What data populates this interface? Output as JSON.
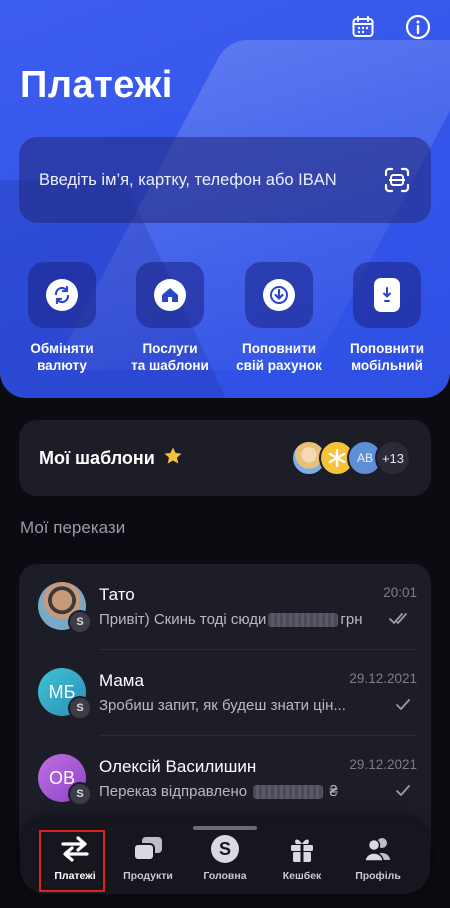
{
  "header": {
    "title": "Платежі",
    "calendar_icon": "calendar-icon",
    "info_icon": "info-icon"
  },
  "search": {
    "placeholder": "Введіть ім’я, картку, телефон або IBAN",
    "scan_icon": "scan-icon"
  },
  "actions": [
    {
      "label": "Обміняти\nвалюту",
      "icon": "exchange-icon"
    },
    {
      "label": "Послуги\nта шаблони",
      "icon": "home-icon"
    },
    {
      "label": "Поповнити\nсвій рахунок",
      "icon": "download-icon"
    },
    {
      "label": "Поповнити\nмобільний",
      "icon": "phone-icon"
    }
  ],
  "templates": {
    "title": "Мої шаблони",
    "avatar_initials": "AB",
    "more_count": "+13"
  },
  "transfers_section": {
    "title": "Мої перекази"
  },
  "transfers": [
    {
      "name": "Тато",
      "time": "20:01",
      "message_start": "Привіт) Скинь тоді сюди",
      "message_end": "грн",
      "badge": "S"
    },
    {
      "name": "Мама",
      "time": "29.12.2021",
      "message_start": "Зробиш запит, як будеш знати цін...",
      "initials": "МБ",
      "badge": "S"
    },
    {
      "name": "Олексій Василишин",
      "time": "29.12.2021",
      "message_start": "Переказ відправлено",
      "message_end": "₴",
      "initials": "ОВ",
      "badge": "S"
    }
  ],
  "tabbar": [
    {
      "label": "Платежі",
      "icon": "transfer-arrows-icon",
      "active": true
    },
    {
      "label": "Продукти",
      "icon": "cards-icon"
    },
    {
      "label": "Головна",
      "icon": "dollar-coin-icon"
    },
    {
      "label": "Кешбек",
      "icon": "gift-icon"
    },
    {
      "label": "Профіль",
      "icon": "profile-icon"
    }
  ],
  "colors": {
    "hero": "#3456ea",
    "card": "#1d1d28",
    "background": "#0b0b12",
    "active_tab_outline": "#e02020"
  }
}
